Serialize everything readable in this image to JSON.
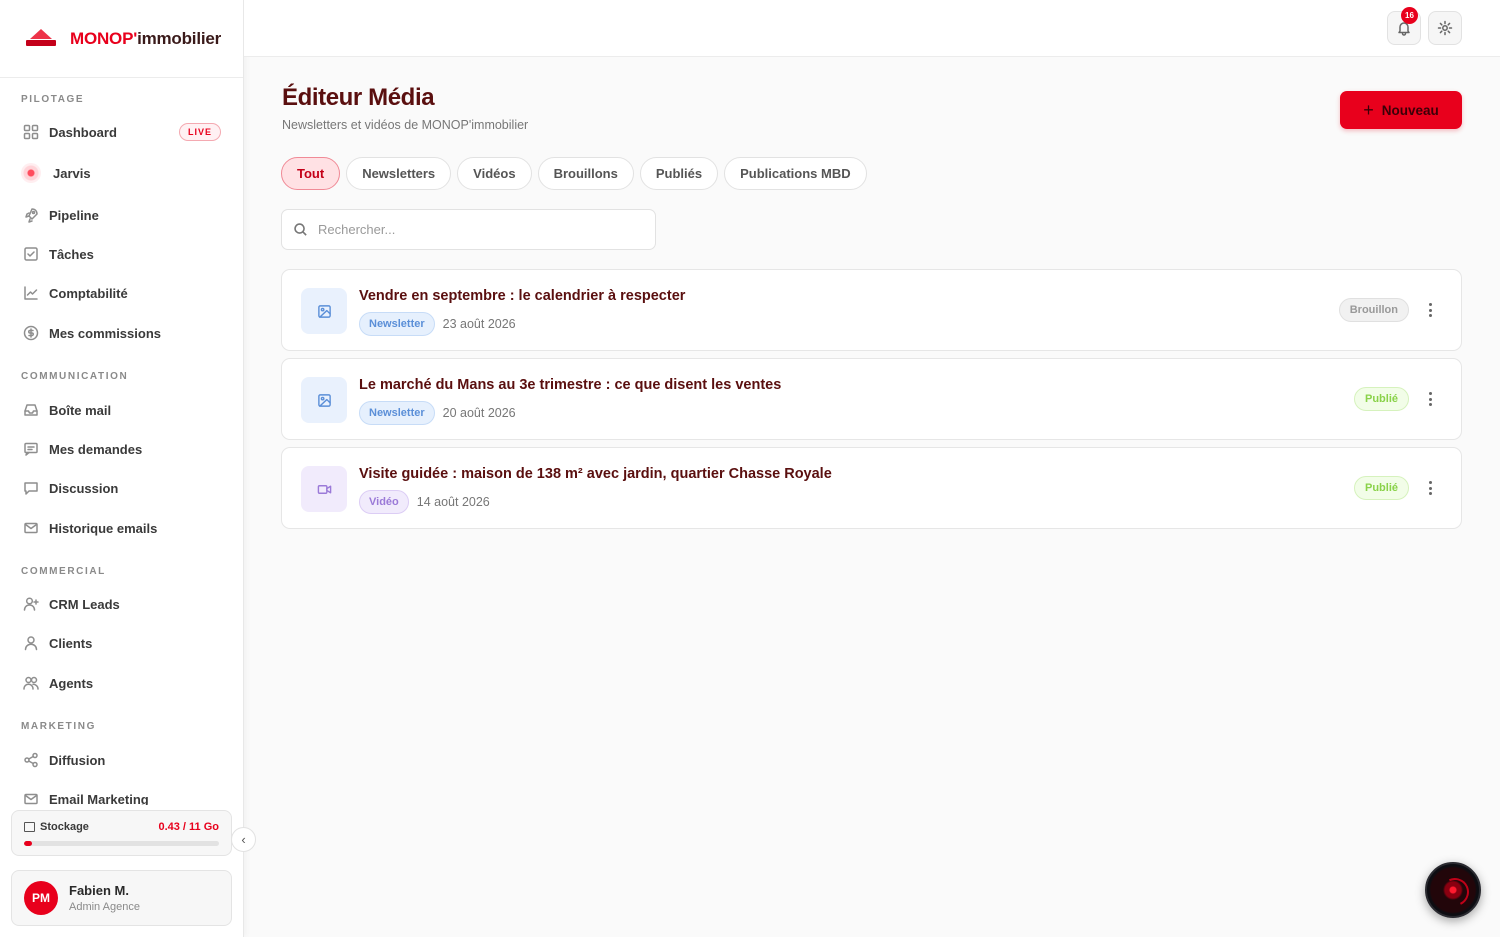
{
  "brand": {
    "logo_red": "MONOP'",
    "logo_dark": "immobilier"
  },
  "sidebar": {
    "sections": {
      "pilotage": "PILOTAGE",
      "communication": "COMMUNICATION",
      "commercial": "COMMERCIAL",
      "marketing": "MARKETING"
    },
    "items": {
      "dashboard": "Dashboard",
      "live_badge": "LIVE",
      "jarvis": "Jarvis",
      "pipeline": "Pipeline",
      "taches": "Tâches",
      "comptabilite": "Comptabilité",
      "commissions": "Mes commissions",
      "boite_mail": "Boîte mail",
      "demandes": "Mes demandes",
      "discussion": "Discussion",
      "historique": "Historique emails",
      "crm": "CRM Leads",
      "clients": "Clients",
      "agents": "Agents",
      "diffusion": "Diffusion",
      "email_marketing": "Email Marketing"
    },
    "storage": {
      "label": "Stockage",
      "value": "0.43 / 11 Go",
      "fraction": 0.04
    },
    "collapse_icon": "chevron-left-icon",
    "user": {
      "initials": "PM",
      "name": "Fabien M.",
      "role": "Admin Agence"
    }
  },
  "topbar": {
    "notification_count": "16",
    "icons": [
      "bell-icon",
      "gear-icon"
    ]
  },
  "main": {
    "title": "Éditeur Média",
    "subtitle": "Newsletters et vidéos de MONOP'immobilier",
    "new_button": "Nouveau",
    "tabs": [
      "Tout",
      "Newsletters",
      "Vidéos",
      "Brouillons",
      "Publiés",
      "Publications MBD"
    ],
    "active_tab": "Tout",
    "search_placeholder": "Rechercher...",
    "items": [
      {
        "title": "Vendre en septembre : le calendrier à respecter",
        "type": "Newsletter",
        "date": "23 août 2026",
        "status": "Brouillon"
      },
      {
        "title": "Le marché du Mans au 3e trimestre : ce que disent les ventes",
        "type": "Newsletter",
        "date": "20 août 2026",
        "status": "Publié"
      },
      {
        "title": "Visite guidée : maison de 138 m² avec jardin, quartier Chasse Royale",
        "type": "Vidéo",
        "date": "14 août 2026",
        "status": "Publié"
      }
    ]
  },
  "colors": {
    "accent": "#e8001c",
    "title": "#5a0f0f",
    "published": "#8ad24a",
    "newsletter": "#5b8fd8",
    "video": "#9b7ad8"
  }
}
